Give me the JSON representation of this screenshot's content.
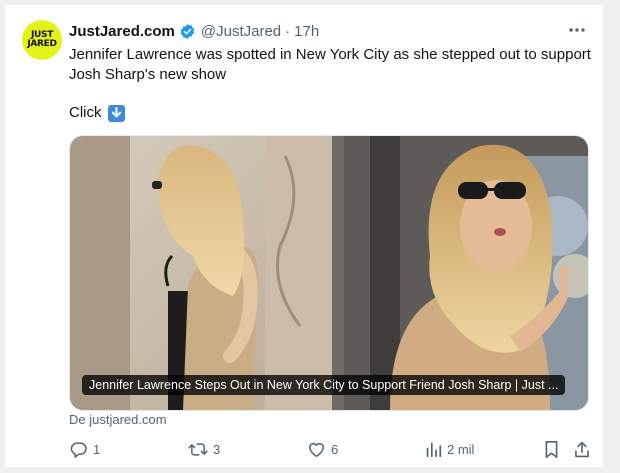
{
  "account": {
    "avatar_line1": "JUST",
    "avatar_line2": "JARED",
    "name": "JustJared.com",
    "handle": "@JustJared",
    "separator": "·",
    "time": "17h",
    "verified_color": "#1d9bf0"
  },
  "tweet": {
    "text": "Jennifer Lawrence was spotted in New York City as she stepped out to support Josh Sharp's new show",
    "click_label": "Click",
    "click_emoji": "down-arrow-icon"
  },
  "card": {
    "caption": "Jennifer Lawrence Steps Out in New York City to Support Friend Josh Sharp | Just ...",
    "source": "De justjared.com"
  },
  "actions": {
    "replies": "1",
    "retweets": "3",
    "likes": "6",
    "views": "2 mil"
  },
  "icons": {
    "reply": "reply-icon",
    "retweet": "retweet-icon",
    "like": "heart-icon",
    "views": "views-icon",
    "bookmark": "bookmark-icon",
    "share": "share-icon",
    "more": "more-icon"
  }
}
